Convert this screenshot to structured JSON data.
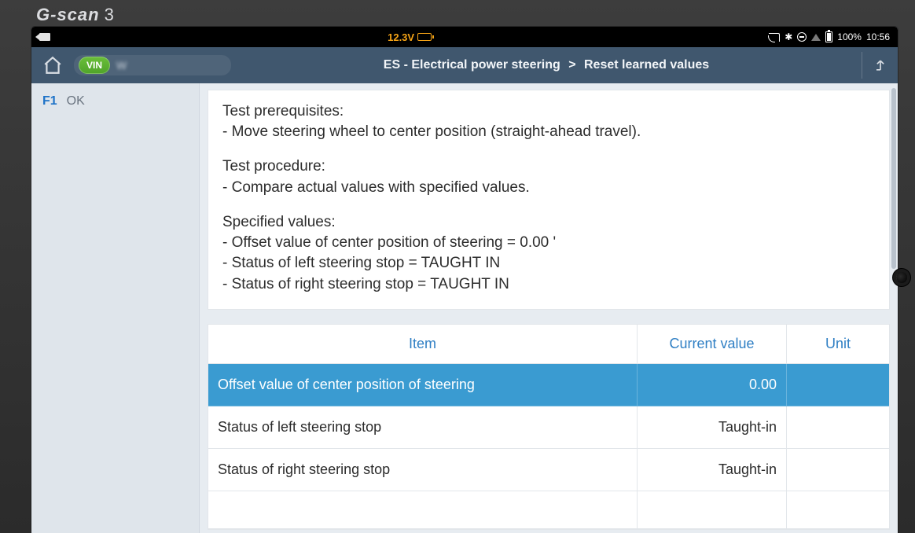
{
  "brand": {
    "name": "G-scan",
    "model": "3"
  },
  "statusbar": {
    "voltage": "12.3V",
    "battery_pct": "100%",
    "time": "10:56"
  },
  "toolbar": {
    "vin_badge": "VIN",
    "vin_value": "W",
    "breadcrumb_system": "ES - Electrical power steering",
    "breadcrumb_sep": ">",
    "breadcrumb_function": "Reset learned values"
  },
  "sidebar": {
    "items": [
      {
        "fkey": "F1",
        "label": "OK"
      }
    ]
  },
  "instructions": {
    "groups": [
      {
        "title": "Test prerequisites:",
        "lines": [
          "- Move steering wheel to center position (straight-ahead travel)."
        ]
      },
      {
        "title": "Test procedure:",
        "lines": [
          "- Compare actual values with specified values."
        ]
      },
      {
        "title": "Specified values:",
        "lines": [
          "- Offset value of center position of steering = 0.00 '",
          "- Status of left steering stop = TAUGHT IN",
          "- Status of right steering stop = TAUGHT IN"
        ]
      }
    ]
  },
  "table": {
    "headers": {
      "item": "Item",
      "value": "Current value",
      "unit": "Unit"
    },
    "rows": [
      {
        "item": "Offset value of center position of steering",
        "value": "0.00",
        "unit": "",
        "selected": true
      },
      {
        "item": "Status of left steering stop",
        "value": "Taught-in",
        "unit": "",
        "selected": false
      },
      {
        "item": "Status of right steering stop",
        "value": "Taught-in",
        "unit": "",
        "selected": false
      }
    ]
  }
}
